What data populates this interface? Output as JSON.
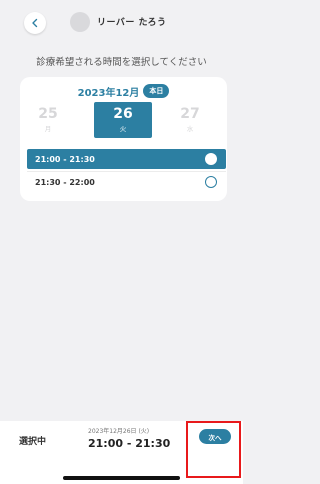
{
  "header": {
    "back_icon": "chevron-left-icon",
    "doctor_name": "リーバー たろう"
  },
  "instruction": "診療希望される時間を選択してください",
  "calendar": {
    "month": "2023年12月",
    "today_badge": "本日",
    "days": [
      {
        "num": "25",
        "weekday": "月",
        "state": "disabled"
      },
      {
        "num": "26",
        "weekday": "火",
        "state": "selected"
      },
      {
        "num": "27",
        "weekday": "水",
        "state": "disabled"
      }
    ]
  },
  "slots": [
    {
      "label": "21:00 - 21:30",
      "selected": true
    },
    {
      "label": "21:30 - 22:00",
      "selected": false
    }
  ],
  "footer": {
    "selected_label": "選択中",
    "selected_date": "2023年12月26日 (火)",
    "selected_time": "21:00 - 21:30",
    "next_label": "次へ"
  },
  "colors": {
    "accent": "#2c7fa2",
    "background": "#f1f1f3",
    "highlight": "#e8191b"
  }
}
